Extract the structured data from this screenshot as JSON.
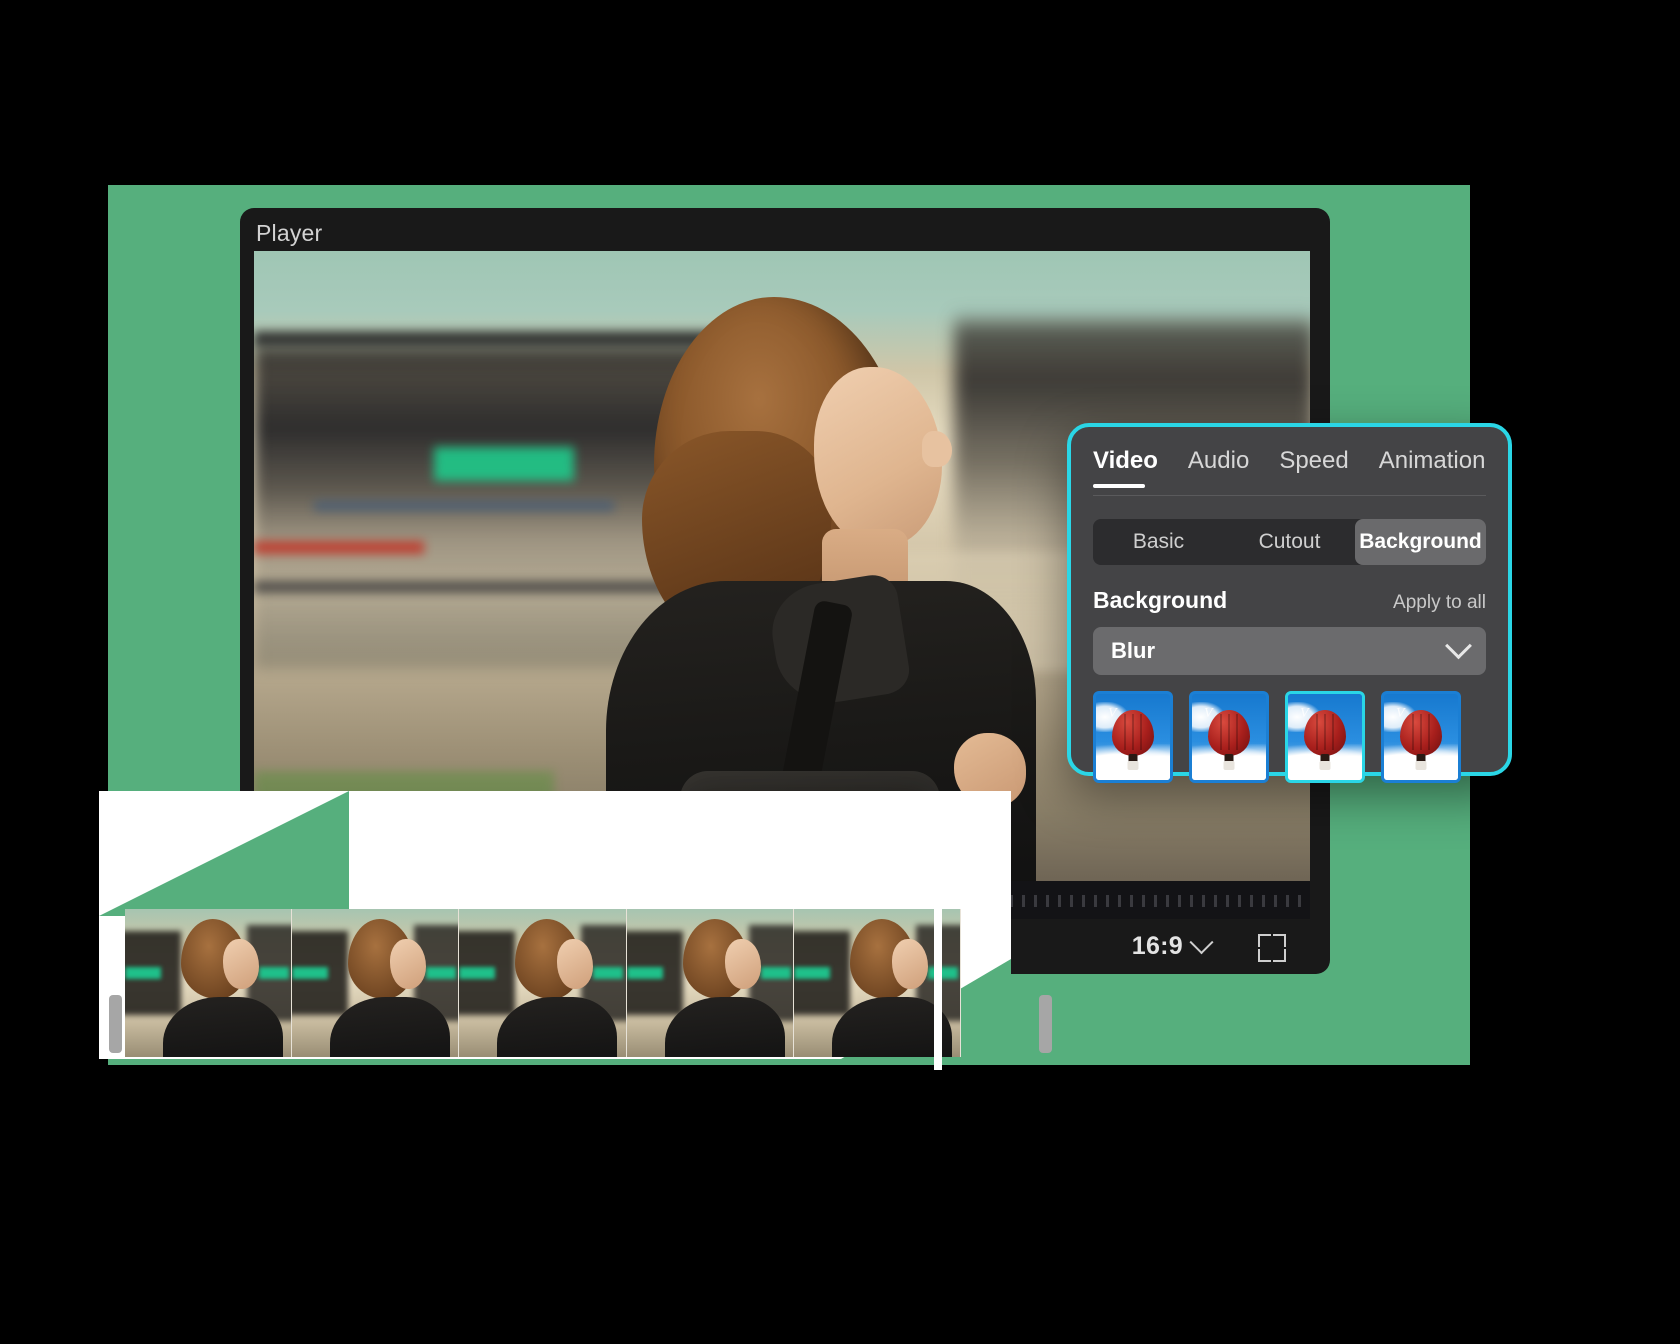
{
  "theme": {
    "brand_green": "#56AF7D",
    "accent_cyan": "#2AD6E6",
    "panel_bg": "#444446",
    "window_bg": "#191919"
  },
  "player": {
    "title": "Player",
    "aspect_ratio": "16:9",
    "aspect_icon": "chevron-down-icon",
    "fullscreen_icon": "fullscreen-icon"
  },
  "properties_panel": {
    "tabs": [
      {
        "label": "Video",
        "active": true
      },
      {
        "label": "Audio",
        "active": false
      },
      {
        "label": "Speed",
        "active": false
      },
      {
        "label": "Animation",
        "active": false
      }
    ],
    "segments": [
      {
        "label": "Basic",
        "active": false
      },
      {
        "label": "Cutout",
        "active": false
      },
      {
        "label": "Background",
        "active": true
      }
    ],
    "section_title": "Background",
    "apply_to_all": "Apply to all",
    "select_value": "Blur",
    "select_icon": "chevron-down-icon",
    "thumbnails": [
      {
        "name": "balloon-preset-1",
        "selected": false
      },
      {
        "name": "balloon-preset-2",
        "selected": false
      },
      {
        "name": "balloon-preset-3",
        "selected": true
      },
      {
        "name": "balloon-preset-4",
        "selected": false
      }
    ]
  },
  "timeline": {
    "playhead_name": "playhead",
    "clip_name": "video-clip-strip",
    "trim_left": "trim-handle-left",
    "trim_right": "trim-handle-right"
  }
}
